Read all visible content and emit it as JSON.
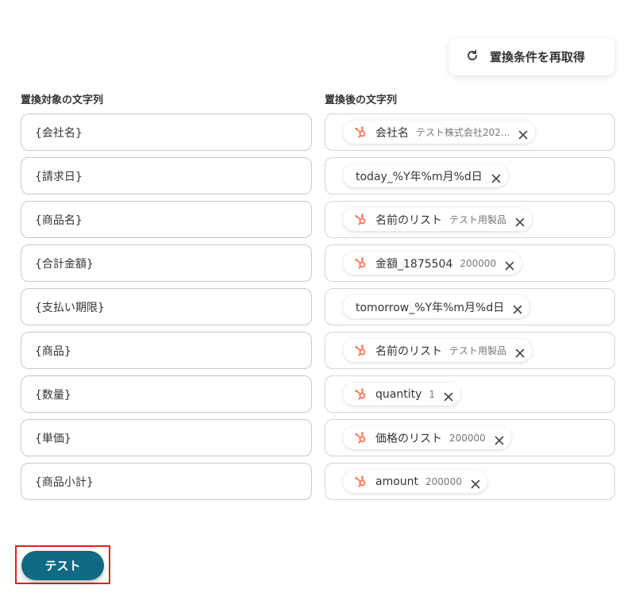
{
  "refresh_button": {
    "label": "置換条件を再取得",
    "icon": "refresh-icon"
  },
  "columns": {
    "source_label": "置換対象の文字列",
    "target_label": "置換後の文字列"
  },
  "rows": [
    {
      "source": "{会社名}",
      "chip": {
        "hubspot": true,
        "label": "会社名",
        "value": "テスト株式会社202..."
      }
    },
    {
      "source": "{請求日}",
      "chip": {
        "hubspot": false,
        "label": "today_%Y年%m月%d日",
        "value": ""
      }
    },
    {
      "source": "{商品名}",
      "chip": {
        "hubspot": true,
        "label": "名前のリスト",
        "value": "テスト用製品"
      }
    },
    {
      "source": "{合計金額}",
      "chip": {
        "hubspot": true,
        "label": "金額_1875504",
        "value": "200000"
      }
    },
    {
      "source": "{支払い期限}",
      "chip": {
        "hubspot": false,
        "label": "tomorrow_%Y年%m月%d日",
        "value": ""
      }
    },
    {
      "source": "{商品}",
      "chip": {
        "hubspot": true,
        "label": "名前のリスト",
        "value": "テスト用製品"
      }
    },
    {
      "source": "{数量}",
      "chip": {
        "hubspot": true,
        "label": "quantity",
        "value": "1"
      }
    },
    {
      "source": "{単価}",
      "chip": {
        "hubspot": true,
        "label": "価格のリスト",
        "value": "200000"
      }
    },
    {
      "source": "{商品小計}",
      "chip": {
        "hubspot": true,
        "label": "amount",
        "value": "200000"
      }
    }
  ],
  "test_button": {
    "label": "テスト"
  },
  "colors": {
    "hubspot_orange": "#ff7a59",
    "primary": "#106a84",
    "highlight": "#e02020"
  }
}
